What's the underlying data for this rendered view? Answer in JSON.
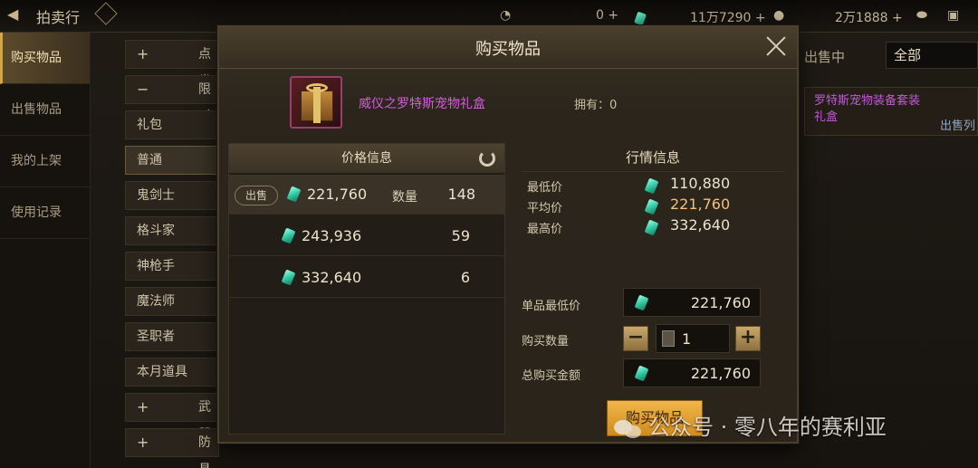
{
  "topbar": {
    "title": "拍卖行",
    "currency_a": "0 +",
    "currency_b": "11万7290 +",
    "currency_c": "2万1888 +"
  },
  "leftnav": {
    "items": [
      {
        "label": "购买物品",
        "active": true
      },
      {
        "label": "出售物品",
        "active": false
      },
      {
        "label": "我的上架",
        "active": false
      },
      {
        "label": "使用记录",
        "active": false
      }
    ]
  },
  "categories": [
    {
      "sign": "+",
      "label": "点券"
    },
    {
      "sign": "−",
      "label": "限时"
    },
    {
      "label": "礼包"
    },
    {
      "label": "普通"
    },
    {
      "label": "鬼剑士"
    },
    {
      "label": "格斗家"
    },
    {
      "label": "神枪手"
    },
    {
      "label": "魔法师"
    },
    {
      "label": "圣职者"
    },
    {
      "label": "本月道具"
    },
    {
      "sign": "+",
      "label": "武器"
    },
    {
      "sign": "+",
      "label": "防具"
    }
  ],
  "background_right": {
    "tab_label": "出售中",
    "filter_value": "全部",
    "item_name": "罗特斯宠物装备套装礼盒",
    "sub_label": "出售列"
  },
  "modal": {
    "title": "购买物品",
    "item": {
      "name": "威仪之罗特斯宠物礼盒",
      "owned_label": "拥有：0"
    },
    "price_panel": {
      "header": "价格信息",
      "sell_tag": "出售",
      "qty_label": "数量",
      "rows": [
        {
          "price": "221,760",
          "qty": "148"
        },
        {
          "price": "243,936",
          "qty": "59"
        },
        {
          "price": "332,640",
          "qty": "6"
        }
      ]
    },
    "market_panel": {
      "header": "行情信息",
      "min_label": "最低价",
      "min_value": "110,880",
      "avg_label": "平均价",
      "avg_value": "221,760",
      "max_label": "最高价",
      "max_value": "332,640"
    },
    "form": {
      "unit_min_label": "单品最低价",
      "unit_min_value": "221,760",
      "buy_qty_label": "购买数量",
      "buy_qty_value": "1",
      "total_label": "总购买金额",
      "total_value": "221,760"
    },
    "buy_button": "购买物品"
  },
  "watermark": {
    "text": "公众号 · 零八年的赛利亚"
  },
  "colors": {
    "accent_gold": "#d2a54c",
    "item_name_purple": "#d65ae0",
    "average_price": "#f3c07a",
    "gem_teal": "#34c9a3"
  }
}
